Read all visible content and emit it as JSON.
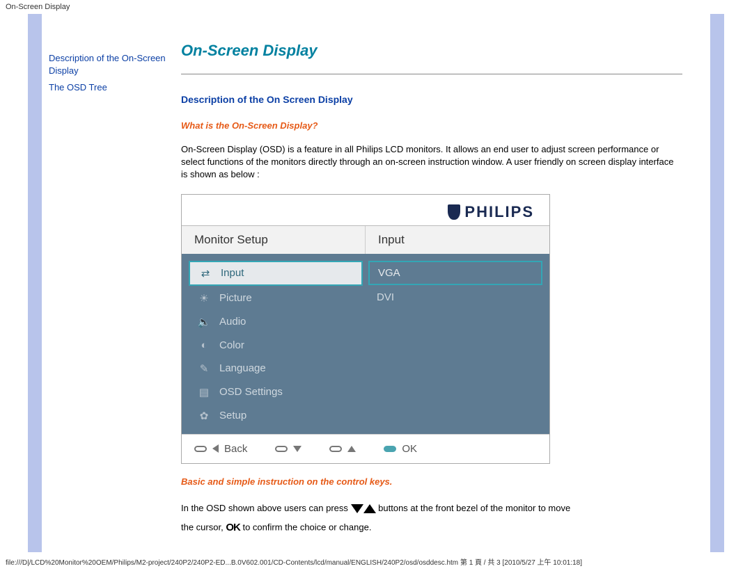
{
  "top_title": "On-Screen Display",
  "sidebar": {
    "links": [
      "Description of the On-Screen Display",
      "The OSD Tree"
    ]
  },
  "main": {
    "heading": "On-Screen Display",
    "section_heading": "Description of the On Screen Display",
    "subheading1": "What is the On-Screen Display?",
    "paragraph1": "On-Screen Display (OSD) is a feature in all Philips LCD monitors. It allows an end user to adjust screen performance or select functions of the monitors directly through an on-screen instruction window. A user friendly on screen display interface is shown as below :",
    "subheading2": "Basic and simple instruction on the control keys.",
    "instr_a": "In the OSD shown above users can press",
    "instr_b": "buttons at the front bezel of the monitor to move",
    "instr_c": "the cursor,",
    "instr_d": "to confirm the choice or change."
  },
  "osd": {
    "brand": "PHILIPS",
    "left_header": "Monitor Setup",
    "right_header": "Input",
    "left_items": [
      {
        "icon": "⇄",
        "label": "Input",
        "selected": true
      },
      {
        "icon": "☀",
        "label": "Picture",
        "selected": false
      },
      {
        "icon": "🔈",
        "label": "Audio",
        "selected": false
      },
      {
        "icon": "◐",
        "label": "Color",
        "selected": false
      },
      {
        "icon": "✎",
        "label": "Language",
        "selected": false
      },
      {
        "icon": "▤",
        "label": "OSD Settings",
        "selected": false
      },
      {
        "icon": "✿",
        "label": "Setup",
        "selected": false
      }
    ],
    "right_items": [
      {
        "label": "VGA",
        "selected": true
      },
      {
        "label": "DVI",
        "selected": false
      }
    ],
    "footer": {
      "back": "Back",
      "ok": "OK"
    }
  },
  "footer_path": "file:///D|/LCD%20Monitor%20OEM/Philips/M2-project/240P2/240P2-ED...B.0V602.001/CD-Contents/lcd/manual/ENGLISH/240P2/osd/osddesc.htm 第 1 頁 / 共 3  [2010/5/27 上午 10:01:18]"
}
